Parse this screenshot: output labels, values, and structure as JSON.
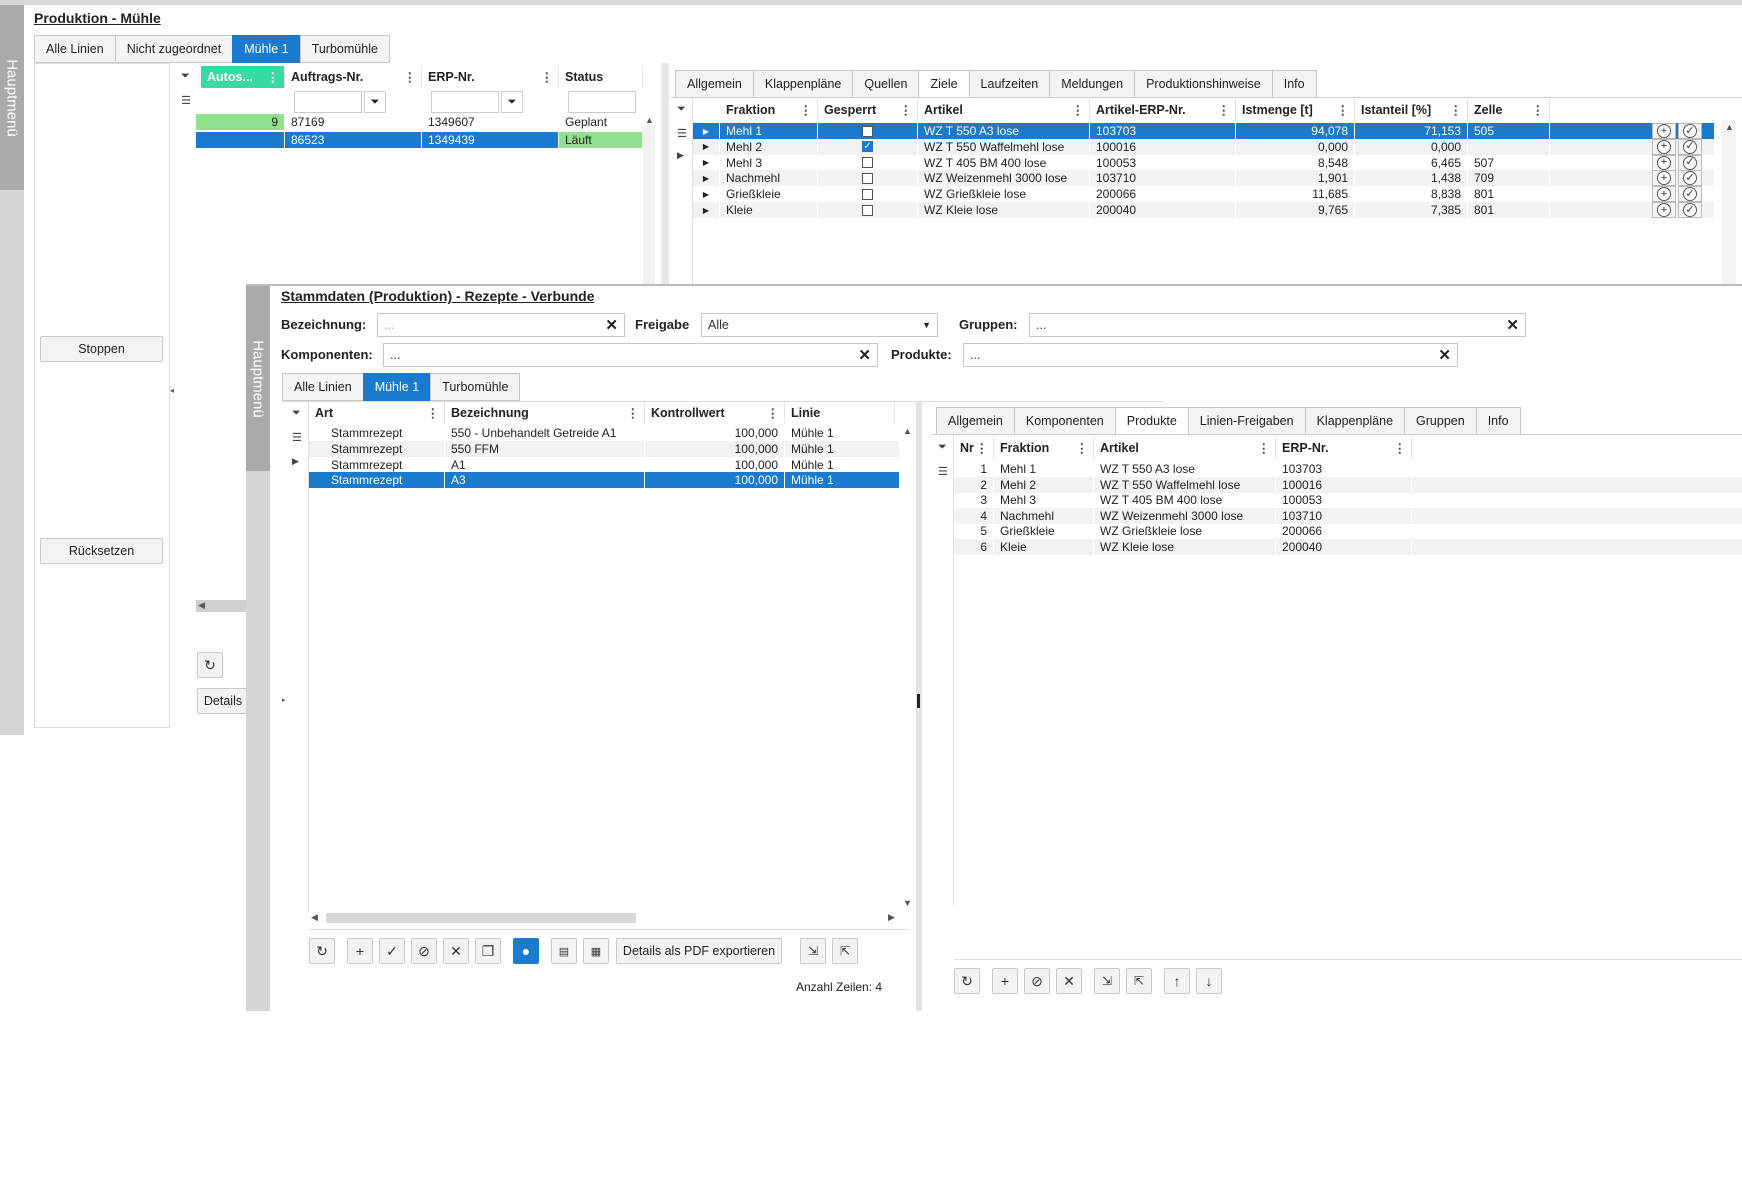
{
  "top": {
    "menu_label": "Hauptmenü",
    "title": "Produktion - Mühle",
    "tabs": [
      "Alle Linien",
      "Nicht zugeordnet",
      "Mühle 1",
      "Turbomühle"
    ],
    "buttons": {
      "stop": "Stoppen",
      "reset": "Rücksetzen",
      "details": "Details"
    },
    "orders": {
      "columns": [
        "Autos...",
        "Auftrags-Nr.",
        "ERP-Nr.",
        "Status"
      ],
      "rows": [
        {
          "auto": "9",
          "auftrag": "87169",
          "erp": "1349607",
          "status": "Geplant"
        },
        {
          "auto": "",
          "auftrag": "86523",
          "erp": "1349439",
          "status": "Läuft"
        }
      ]
    },
    "detail_tabs": [
      "Allgemein",
      "Klappenpläne",
      "Quellen",
      "Ziele",
      "Laufzeiten",
      "Meldungen",
      "Produktionshinweise",
      "Info"
    ],
    "targets": {
      "columns": [
        "Fraktion",
        "Gesperrt",
        "Artikel",
        "Artikel-ERP-Nr.",
        "Istmenge [t]",
        "Istanteil [%]",
        "Zelle"
      ],
      "rows": [
        {
          "fraktion": "Mehl 1",
          "gesperrt": false,
          "artikel": "WZ T 550 A3 lose",
          "erp": "103703",
          "menge": "94,078",
          "anteil": "71,153",
          "zelle": "505"
        },
        {
          "fraktion": "Mehl 2",
          "gesperrt": true,
          "artikel": "WZ T 550 Waffelmehl lose",
          "erp": "100016",
          "menge": "0,000",
          "anteil": "0,000",
          "zelle": ""
        },
        {
          "fraktion": "Mehl 3",
          "gesperrt": false,
          "artikel": "WZ T 405 BM 400 lose",
          "erp": "100053",
          "menge": "8,548",
          "anteil": "6,465",
          "zelle": "507"
        },
        {
          "fraktion": "Nachmehl",
          "gesperrt": false,
          "artikel": "WZ Weizenmehl 3000 lose",
          "erp": "103710",
          "menge": "1,901",
          "anteil": "1,438",
          "zelle": "709"
        },
        {
          "fraktion": "Grießkleie",
          "gesperrt": false,
          "artikel": "WZ Grießkleie lose",
          "erp": "200066",
          "menge": "11,685",
          "anteil": "8,838",
          "zelle": "801"
        },
        {
          "fraktion": "Kleie",
          "gesperrt": false,
          "artikel": "WZ Kleie lose",
          "erp": "200040",
          "menge": "9,765",
          "anteil": "7,385",
          "zelle": "801"
        }
      ]
    }
  },
  "front": {
    "menu_label": "Hauptmenü",
    "title": "Stammdaten (Produktion) - Rezepte - Verbunde",
    "filters": {
      "bezeichnung_label": "Bezeichnung:",
      "bezeichnung_placeholder": "...",
      "freigabe_label": "Freigabe",
      "freigabe_value": "Alle",
      "gruppen_label": "Gruppen:",
      "gruppen_value": "...",
      "komponenten_label": "Komponenten:",
      "komponenten_value": "...",
      "produkte_label": "Produkte:",
      "produkte_value": "..."
    },
    "tabs": [
      "Alle Linien",
      "Mühle 1",
      "Turbomühle"
    ],
    "recipes": {
      "columns": [
        "Art",
        "Bezeichnung",
        "Kontrollwert",
        "Linie"
      ],
      "rows": [
        {
          "art": "Stammrezept",
          "bez": "550 - Unbehandelt Getreide A1",
          "kontroll": "100,000",
          "linie": "Mühle 1"
        },
        {
          "art": "Stammrezept",
          "bez": "550 FFM",
          "kontroll": "100,000",
          "linie": "Mühle 1"
        },
        {
          "art": "Stammrezept",
          "bez": "A1",
          "kontroll": "100,000",
          "linie": "Mühle 1"
        },
        {
          "art": "Stammrezept",
          "bez": "A3",
          "kontroll": "100,000",
          "linie": "Mühle 1"
        }
      ]
    },
    "pdf_button": "Details als PDF exportieren",
    "row_count": "Anzahl Zeilen: 4",
    "detail_tabs": [
      "Allgemein",
      "Komponenten",
      "Produkte",
      "Linien-Freigaben",
      "Klappenpläne",
      "Gruppen",
      "Info"
    ],
    "products": {
      "columns": [
        "Nr",
        "Fraktion",
        "Artikel",
        "ERP-Nr."
      ],
      "rows": [
        {
          "nr": "1",
          "fraktion": "Mehl 1",
          "artikel": "WZ T 550 A3 lose",
          "erp": "103703"
        },
        {
          "nr": "2",
          "fraktion": "Mehl 2",
          "artikel": "WZ T 550 Waffelmehl lose",
          "erp": "100016"
        },
        {
          "nr": "3",
          "fraktion": "Mehl 3",
          "artikel": "WZ T 405 BM 400 lose",
          "erp": "100053"
        },
        {
          "nr": "4",
          "fraktion": "Nachmehl",
          "artikel": "WZ Weizenmehl 3000 lose",
          "erp": "103710"
        },
        {
          "nr": "5",
          "fraktion": "Grießkleie",
          "artikel": "WZ Grießkleie lose",
          "erp": "200066"
        },
        {
          "nr": "6",
          "fraktion": "Kleie",
          "artikel": "WZ Kleie lose",
          "erp": "200040"
        }
      ]
    }
  },
  "colors": {
    "accent": "#1a7acd",
    "green": "#8fe08f",
    "teal": "#39d9a0",
    "menu_gray": "#aaaaaa"
  }
}
